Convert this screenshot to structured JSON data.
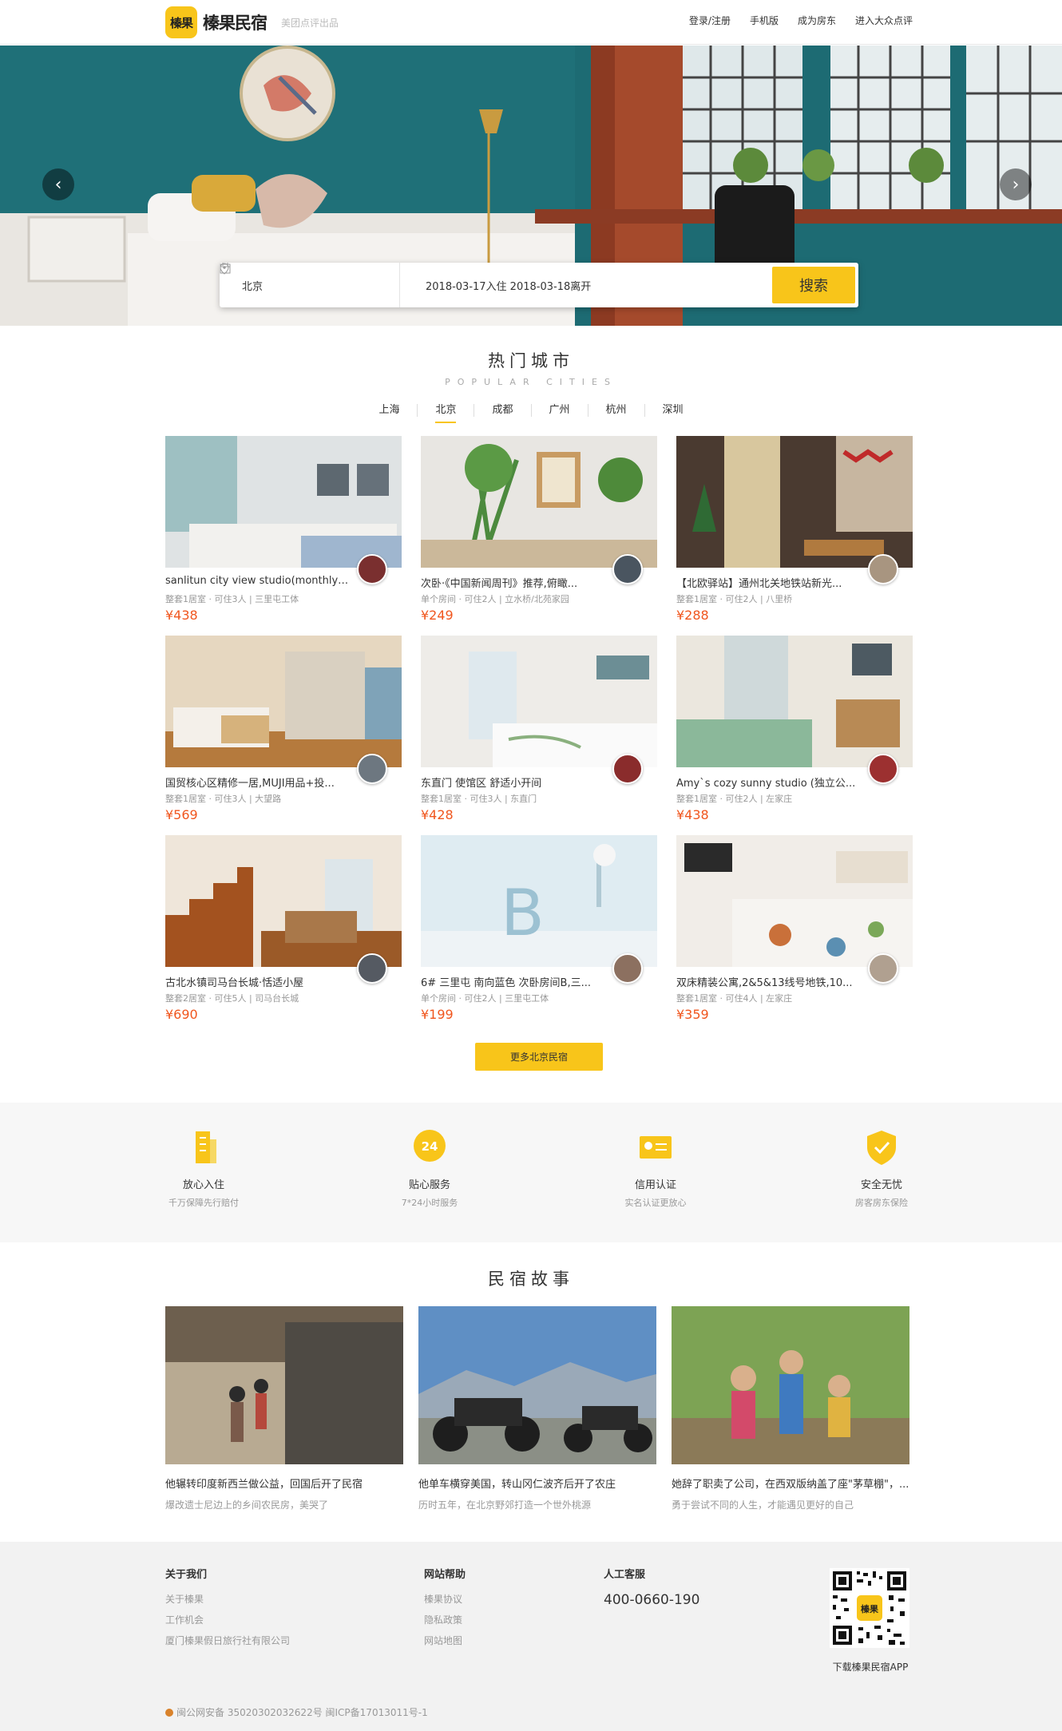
{
  "header": {
    "logo_badge": "榛果",
    "logo_name": "榛果民宿",
    "logo_sub": "美团点评出品",
    "nav": [
      "登录/注册",
      "手机版",
      "成为房东",
      "进入大众点评"
    ]
  },
  "hero": {
    "location": "北京",
    "dates": "2018-03-17入住  2018-03-18离开",
    "search_label": "搜索"
  },
  "cities": {
    "title": "热门城市",
    "subtitle": "POPULAR CITIES",
    "tabs": [
      "上海",
      "北京",
      "成都",
      "广州",
      "杭州",
      "深圳"
    ],
    "active_tab": "北京"
  },
  "listings": [
    {
      "title": "sanlitun city view studio(monthly r...",
      "meta": "整套1居室 · 可住3人 | 三里屯工体",
      "price": "¥438"
    },
    {
      "title": "次卧·《中国新闻周刊》推荐,俯瞰...",
      "meta": "单个房间 · 可住2人 | 立水桥/北苑家园",
      "price": "¥249"
    },
    {
      "title": "【北欧驿站】通州北关地铁站新光...",
      "meta": "整套1居室 · 可住2人 | 八里桥",
      "price": "¥288"
    },
    {
      "title": "国贸核心区精修一居,MUJI用品+投...",
      "meta": "整套1居室 · 可住3人 | 大望路",
      "price": "¥569"
    },
    {
      "title": "东直门 使馆区 舒适小开间",
      "meta": "整套1居室 · 可住3人 | 东直门",
      "price": "¥428"
    },
    {
      "title": "Amy`s cozy sunny studio (独立公...",
      "meta": "整套1居室 · 可住2人 | 左家庄",
      "price": "¥438"
    },
    {
      "title": "古北水镇司马台长城·恬适小屋",
      "meta": "整套2居室 · 可住5人 | 司马台长城",
      "price": "¥690"
    },
    {
      "title": "6# 三里屯 南向蓝色 次卧房间B,三...",
      "meta": "单个房间 · 可住2人 | 三里屯工体",
      "price": "¥199"
    },
    {
      "title": "双床精装公寓,2&5&13线号地铁,10...",
      "meta": "整套1居室 · 可住4人 | 左家庄",
      "price": "¥359"
    }
  ],
  "more_label": "更多北京民宿",
  "features": [
    {
      "title": "放心入住",
      "sub": "千万保障先行赔付",
      "icon": "building-icon"
    },
    {
      "title": "贴心服务",
      "sub": "7*24小时服务",
      "icon": "24h-icon",
      "badge": "24"
    },
    {
      "title": "信用认证",
      "sub": "实名认证更放心",
      "icon": "id-card-icon"
    },
    {
      "title": "安全无忧",
      "sub": "房客房东保险",
      "icon": "shield-icon"
    }
  ],
  "stories": {
    "title": "民宿故事",
    "items": [
      {
        "title": "他辗转印度新西兰做公益，回国后开了民宿",
        "sub": "爆改遗士尼边上的乡间农民房，美哭了"
      },
      {
        "title": "他单车横穿美国，转山冈仁波齐后开了农庄",
        "sub": "历时五年，在北京野郊打造一个世外桃源"
      },
      {
        "title": "她辞了职卖了公司，在西双版纳盖了座\"茅草棚\"，...",
        "sub": "勇于尝试不同的人生，才能遇见更好的自己"
      }
    ]
  },
  "footer": {
    "about_title": "关于我们",
    "about_links": [
      "关于榛果",
      "工作机会",
      "厦门榛果假日旅行社有限公司"
    ],
    "help_title": "网站帮助",
    "help_links": [
      "榛果协议",
      "隐私政策",
      "网站地图"
    ],
    "service_title": "人工客服",
    "phone": "400-0660-190",
    "qr_badge": "榛果",
    "qr_caption": "下载榛果民宿APP",
    "beian": "闽公网安备 35020302032622号   闽ICP备17013011号-1"
  },
  "colors": {
    "accent": "#f8c51a",
    "price": "#f0561e"
  }
}
